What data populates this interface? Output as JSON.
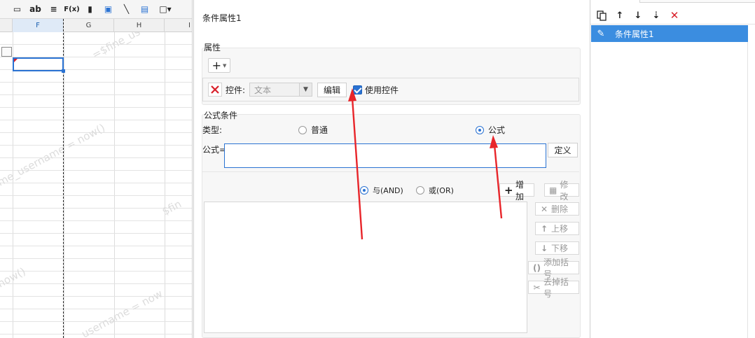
{
  "sheet": {
    "toolbar_icons": [
      "text-field-icon",
      "label-ab-icon",
      "align-lines-icon",
      "formula-fx-icon",
      "bar-chart-icon",
      "image-icon",
      "slash-line-icon",
      "document-icon",
      "border-box-icon"
    ],
    "toolbar_glyphs": [
      "▭",
      "ab",
      "≡",
      "F(x)",
      "▮",
      "▣",
      "╲",
      "▤",
      "□▾"
    ],
    "columns": [
      "F",
      "G",
      "H",
      "I"
    ],
    "selected_column": "F",
    "watermark_texts": [
      "=$fine_us",
      "me_username = now()",
      "$fin",
      "now()",
      "username = now"
    ]
  },
  "dialog": {
    "title": "条件属性1",
    "property_group_label": "属性",
    "add_button": "+",
    "control_label": "控件:",
    "control_select_value": "文本",
    "edit_button": "编辑",
    "use_control_label": "使用控件",
    "use_control_checked": true,
    "formula_group_label": "公式条件",
    "type_label": "类型:",
    "type_options": [
      {
        "label": "普通",
        "selected": false
      },
      {
        "label": "公式",
        "selected": true
      }
    ],
    "formula_label": "公式=",
    "formula_value": "",
    "define_button": "定义",
    "logic_options": [
      {
        "label": "与(AND)",
        "selected": true
      },
      {
        "label": "或(OR)",
        "selected": false
      }
    ],
    "add_cond_button": "增加",
    "modify_button": "修改",
    "delete_button": "删除",
    "move_up_button": "上移",
    "move_down_button": "下移",
    "add_brackets_button": "添加括号",
    "remove_brackets_button": "去掉括号"
  },
  "right_panel": {
    "toolbar_icons": [
      "copy-icon",
      "arrow-up-icon",
      "arrow-down-icon",
      "move-to-bottom-icon",
      "delete-x-icon"
    ],
    "items": [
      {
        "label": "条件属性1",
        "selected": true
      }
    ]
  },
  "colors": {
    "accent": "#2b73d3",
    "selection": "#3b8de0",
    "annotation_red": "#e8252a",
    "delete_red": "#d8202a"
  }
}
